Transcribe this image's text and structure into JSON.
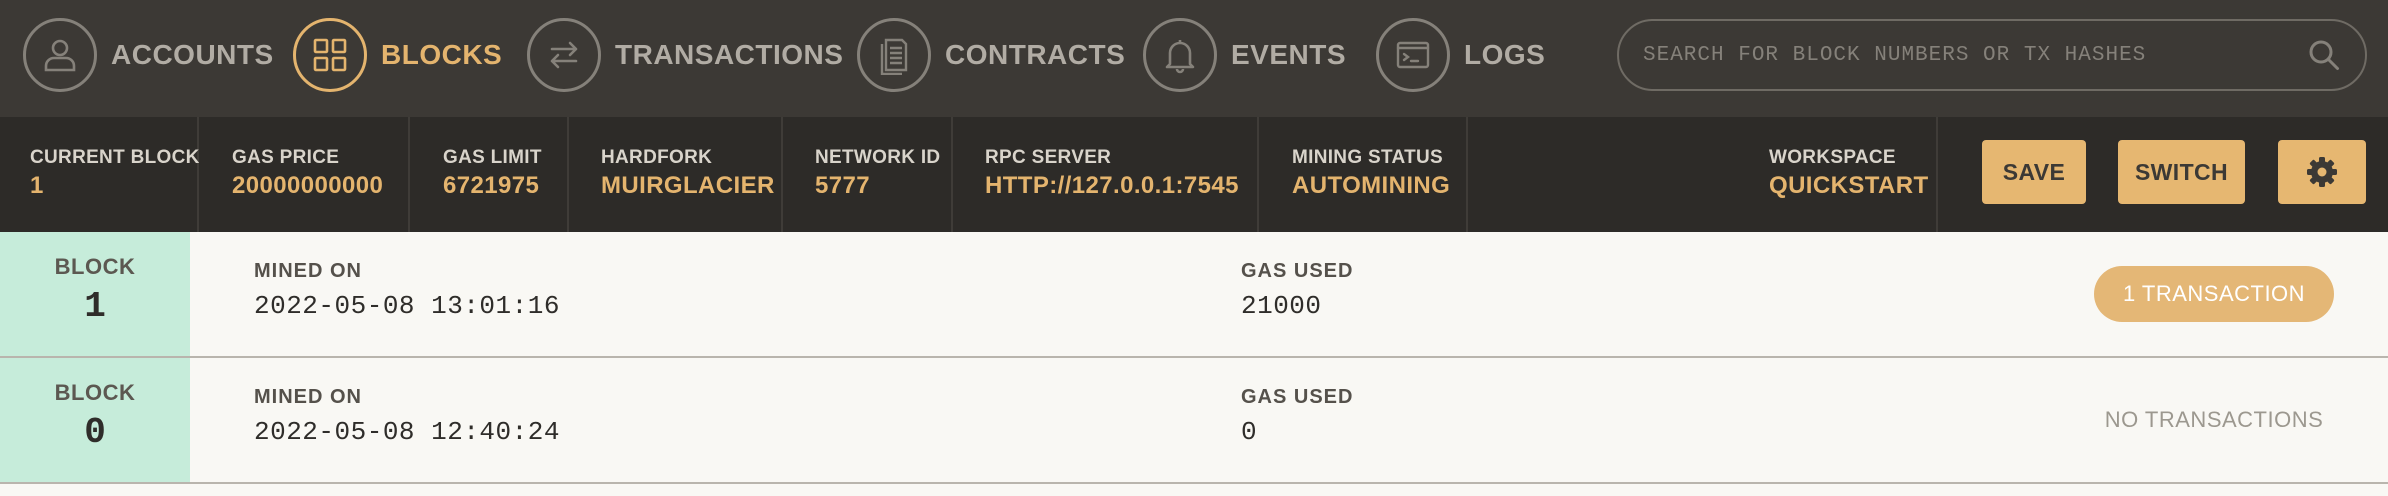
{
  "nav": {
    "items": [
      {
        "label": "ACCOUNTS"
      },
      {
        "label": "BLOCKS",
        "active": true
      },
      {
        "label": "TRANSACTIONS"
      },
      {
        "label": "CONTRACTS"
      },
      {
        "label": "EVENTS"
      },
      {
        "label": "LOGS"
      }
    ],
    "search_placeholder": "SEARCH FOR BLOCK NUMBERS OR TX HASHES"
  },
  "status": {
    "current_block": {
      "label": "CURRENT BLOCK",
      "value": "1"
    },
    "gas_price": {
      "label": "GAS PRICE",
      "value": "20000000000"
    },
    "gas_limit": {
      "label": "GAS LIMIT",
      "value": "6721975"
    },
    "hardfork": {
      "label": "HARDFORK",
      "value": "MUIRGLACIER"
    },
    "network_id": {
      "label": "NETWORK ID",
      "value": "5777"
    },
    "rpc_server": {
      "label": "RPC SERVER",
      "value": "HTTP://127.0.0.1:7545"
    },
    "mining_status": {
      "label": "MINING STATUS",
      "value": "AUTOMINING"
    },
    "workspace": {
      "label": "WORKSPACE",
      "value": "QUICKSTART"
    },
    "save_label": "SAVE",
    "switch_label": "SWITCH"
  },
  "blocks": [
    {
      "block_label": "BLOCK",
      "number": "1",
      "mined_label": "MINED ON",
      "mined_on": "2022-05-08 13:01:16",
      "gas_label": "GAS USED",
      "gas_used": "21000",
      "tx_text": "1 TRANSACTION",
      "has_tx": true
    },
    {
      "block_label": "BLOCK",
      "number": "0",
      "mined_label": "MINED ON",
      "mined_on": "2022-05-08 12:40:24",
      "gas_label": "GAS USED",
      "gas_used": "0",
      "tx_text": "NO TRANSACTIONS",
      "has_tx": false
    }
  ],
  "colors": {
    "nav_bg": "#3c3935",
    "status_bg": "#2d2b28",
    "accent": "#e4b46e",
    "block_cell": "#c6ecda"
  }
}
